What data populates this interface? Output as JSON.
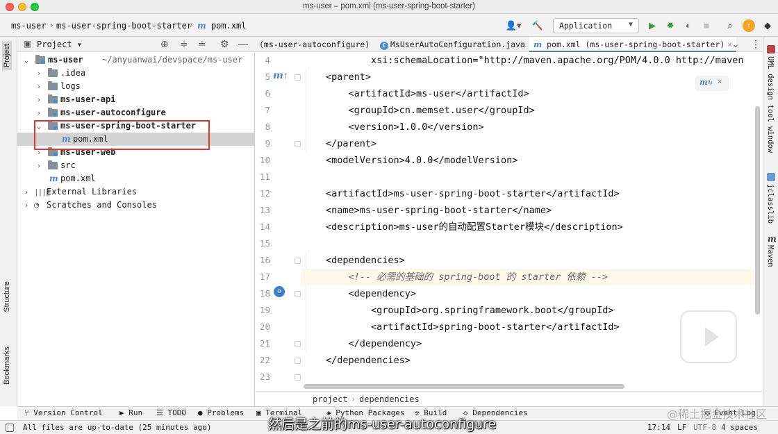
{
  "window": {
    "title": "ms-user – pom.xml (ms-user-spring-boot-starter)"
  },
  "navbar": {
    "breadcrumbs": [
      "ms-user",
      "ms-user-spring-boot-starter",
      "pom.xml"
    ],
    "run_config": "Application"
  },
  "left_strip": {
    "project_tab": "Project",
    "structure_tab": "Structure",
    "bookmarks_tab": "Bookmarks"
  },
  "right_strip": {
    "uml_tab": "UML design tool window",
    "jclasslib_tab": "jclasslib",
    "maven_tab": "Maven"
  },
  "project_panel": {
    "title": "Project",
    "tree": [
      {
        "label": "ms-user",
        "path": "~/anyuanwai/devspace/ms-user",
        "indent": 0,
        "arrow": "v",
        "icon": "module-folder"
      },
      {
        "label": ".idea",
        "indent": 1,
        "arrow": ">",
        "icon": "folder"
      },
      {
        "label": "logs",
        "indent": 1,
        "arrow": ">",
        "icon": "folder"
      },
      {
        "label": "ms-user-api",
        "indent": 1,
        "arrow": ">",
        "icon": "module-folder"
      },
      {
        "label": "ms-user-autoconfigure",
        "indent": 1,
        "arrow": ">",
        "icon": "module-folder"
      },
      {
        "label": "ms-user-spring-boot-starter",
        "indent": 1,
        "arrow": "v",
        "icon": "module-folder"
      },
      {
        "label": "pom.xml",
        "indent": 2,
        "arrow": "",
        "icon": "maven-file",
        "selected": true
      },
      {
        "label": "ms-user-web",
        "indent": 1,
        "arrow": ">",
        "icon": "module-folder"
      },
      {
        "label": "src",
        "indent": 1,
        "arrow": ">",
        "icon": "folder"
      },
      {
        "label": "pom.xml",
        "indent": 1,
        "arrow": "",
        "icon": "maven-file"
      },
      {
        "label": "External Libraries",
        "indent": 0,
        "arrow": ">",
        "icon": "libraries"
      },
      {
        "label": "Scratches and Consoles",
        "indent": 0,
        "arrow": ">",
        "icon": "scratches"
      }
    ]
  },
  "editor": {
    "tabs": [
      {
        "label": "(ms-user-autoconfigure)",
        "active": false
      },
      {
        "label": "MsUserAutoConfiguration.java",
        "active": false,
        "icon": "C"
      },
      {
        "label": "pom.xml (ms-user-spring-boot-starter)",
        "active": true,
        "icon": "m"
      }
    ],
    "lines": [
      {
        "num": "4",
        "text": "        xsi:schemaLocation=\"http://maven.apache.org/POM/4.0.0 http://maven"
      },
      {
        "num": "5",
        "text": "<parent>"
      },
      {
        "num": "6",
        "text": "    <artifactId>ms-user</artifactId>"
      },
      {
        "num": "7",
        "text": "    <groupId>cn.memset.user</groupId>"
      },
      {
        "num": "8",
        "text": "    <version>1.0.0</version>"
      },
      {
        "num": "9",
        "text": "</parent>"
      },
      {
        "num": "10",
        "text": "<modelVersion>4.0.0</modelVersion>"
      },
      {
        "num": "11",
        "text": ""
      },
      {
        "num": "12",
        "text": "<artifactId>ms-user-spring-boot-starter</artifactId>"
      },
      {
        "num": "13",
        "text": "<name>ms-user-spring-boot-starter</name>"
      },
      {
        "num": "14",
        "text": "<description>ms-user的自动配置Starter模块</description>"
      },
      {
        "num": "15",
        "text": ""
      },
      {
        "num": "16",
        "text": "<dependencies>"
      },
      {
        "num": "17",
        "text": "    <!-- 必需的基础的 spring-boot 的 starter 依赖 -->",
        "comment": true,
        "current": true
      },
      {
        "num": "18",
        "text": "    <dependency>"
      },
      {
        "num": "19",
        "text": "        <groupId>org.springframework.boot</groupId>"
      },
      {
        "num": "20",
        "text": "        <artifactId>spring-boot-starter</artifactId>"
      },
      {
        "num": "21",
        "text": "    </dependency>"
      },
      {
        "num": "22",
        "text": "</dependencies>"
      },
      {
        "num": "23",
        "text": ""
      }
    ],
    "breadcrumb": [
      "project",
      "dependencies"
    ]
  },
  "toolwindows": [
    "Version Control",
    "Run",
    "TODO",
    "Problems",
    "Terminal",
    "Python Packages",
    "Build",
    "Dependencies",
    "Event Log"
  ],
  "status": {
    "message": "All files are up-to-date (25 minutes ago)",
    "position": "17:14",
    "line_sep": "LF",
    "encoding": "UTF-8",
    "indent": "4 spaces"
  },
  "overlay": {
    "subtitle": "然后是之前的ms-user-autoconfigure",
    "watermark": "@稀土掘金技术社区"
  }
}
